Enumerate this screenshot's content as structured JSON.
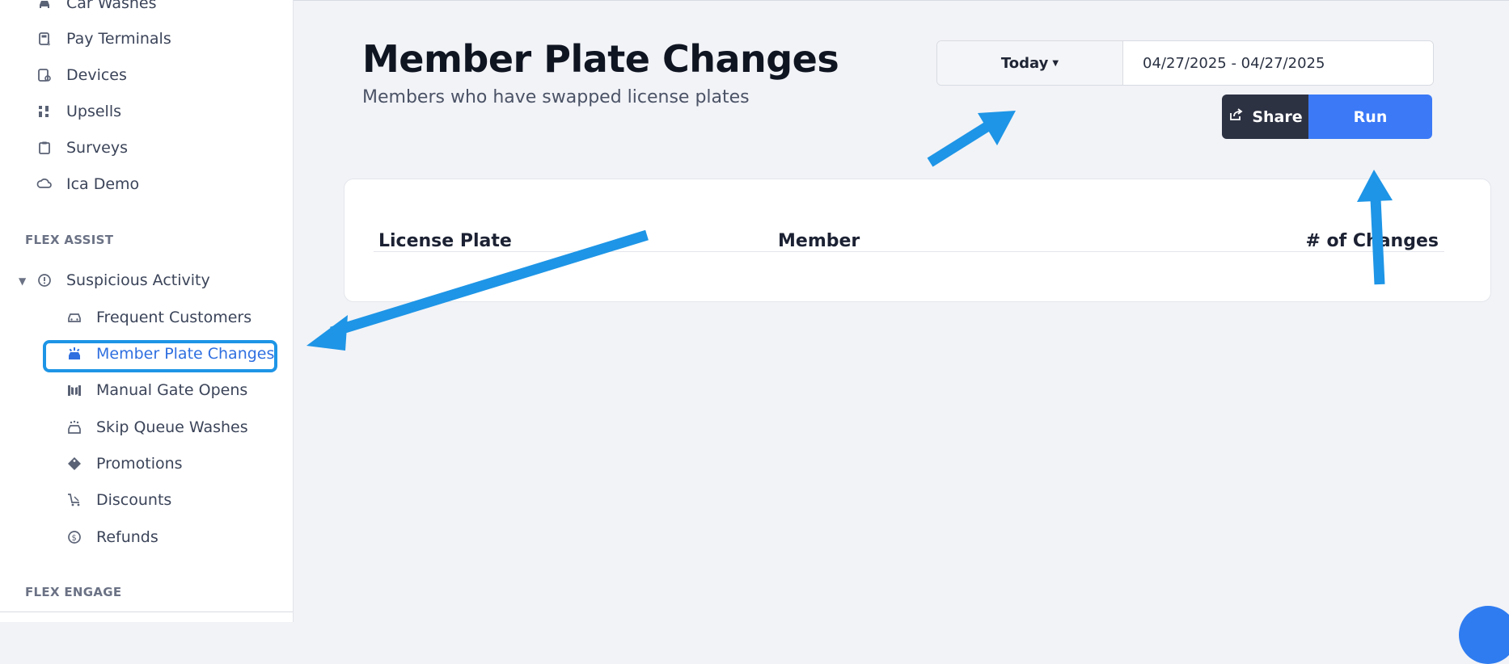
{
  "sidebar": {
    "items": [
      {
        "label": "Car Washes",
        "icon": "car-icon"
      },
      {
        "label": "Pay Terminals",
        "icon": "pay-terminal-icon"
      },
      {
        "label": "Devices",
        "icon": "devices-icon"
      },
      {
        "label": "Upsells",
        "icon": "upsells-icon"
      },
      {
        "label": "Surveys",
        "icon": "clipboard-icon"
      },
      {
        "label": "Ica Demo",
        "icon": "cloud-icon"
      }
    ],
    "section_flex_assist": "FLEX ASSIST",
    "group": {
      "label": "Suspicious Activity",
      "icon": "alert-circle-icon",
      "expanded": true
    },
    "sub_items": [
      {
        "label": "Frequent Customers",
        "icon": "car-front-icon"
      },
      {
        "label": "Member Plate Changes",
        "icon": "car-alert-icon",
        "active": true
      },
      {
        "label": "Manual Gate Opens",
        "icon": "gate-icon"
      },
      {
        "label": "Skip Queue Washes",
        "icon": "car-wash-icon"
      },
      {
        "label": "Promotions",
        "icon": "tag-icon"
      },
      {
        "label": "Discounts",
        "icon": "cart-discount-icon"
      },
      {
        "label": "Refunds",
        "icon": "refund-icon"
      }
    ],
    "section_flex_engage": "FLEX ENGAGE"
  },
  "header": {
    "title": "Member Plate Changes",
    "subtitle": "Members who have swapped license plates"
  },
  "controls": {
    "date_preset": "Today",
    "date_range": "04/27/2025 - 04/27/2025",
    "share_label": "Share",
    "run_label": "Run"
  },
  "table": {
    "columns": [
      "License Plate",
      "Member",
      "# of Changes"
    ],
    "rows": []
  },
  "colors": {
    "accent": "#3b79f6",
    "active_nav": "#2f6fe0",
    "annotation_arrow": "#1e95e6",
    "share_bg": "#2d3243"
  }
}
